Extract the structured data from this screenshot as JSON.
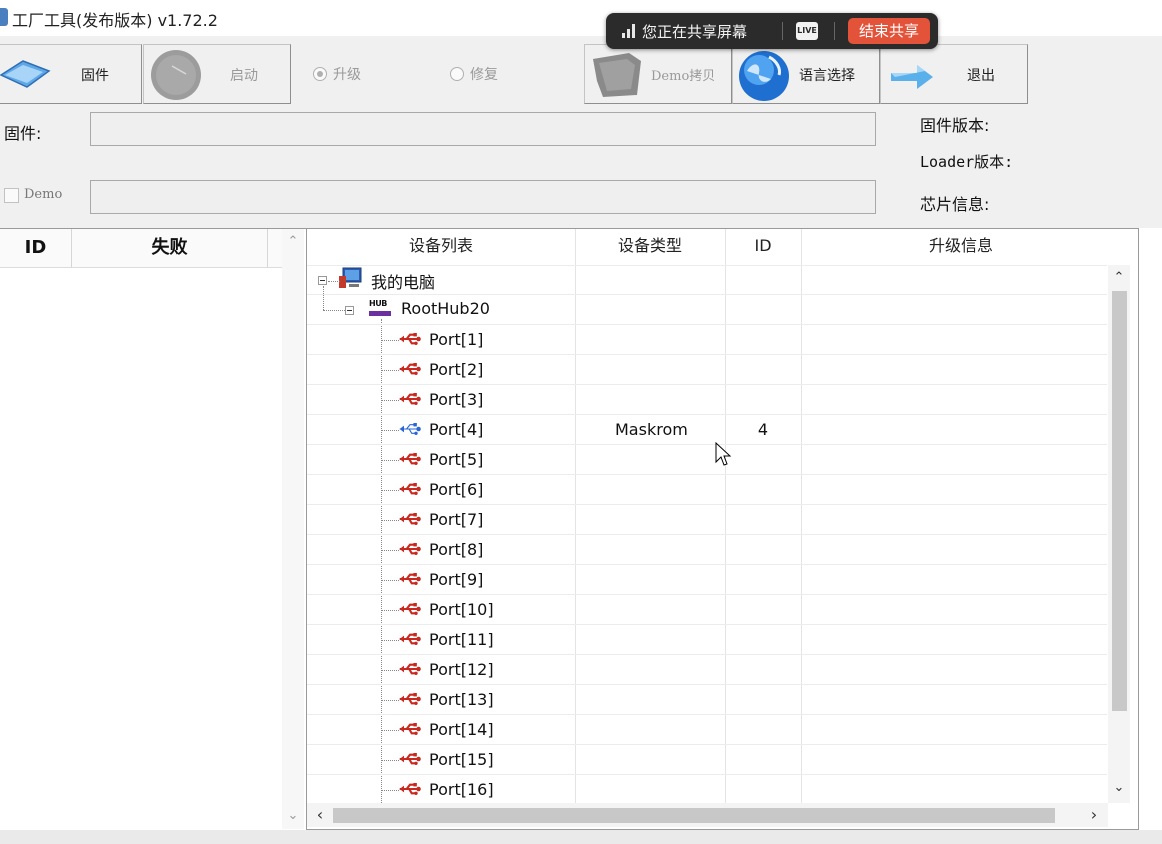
{
  "window": {
    "title": "工厂工具(发布版本) v1.72.2"
  },
  "share_bar": {
    "status": "您正在共享屏幕",
    "stop_label": "结束共享",
    "live_icon_text": "LIVE"
  },
  "toolbar": {
    "firmware_button": "固件",
    "start_button": "启动",
    "upgrade_radio": "升级",
    "repair_radio": "修复",
    "demo_copy_button": "Demo拷贝",
    "language_button": "语言选择",
    "exit_button": "退出"
  },
  "info": {
    "firmware_label": "固件:",
    "firmware_path": "",
    "demo_label": "Demo",
    "demo_path": "",
    "firmware_version_label": "固件版本:",
    "loader_version_label": "Loader版本:",
    "chip_info_label": "芯片信息:"
  },
  "left_table": {
    "columns": [
      "ID",
      "失败"
    ]
  },
  "device_table": {
    "columns": [
      "设备列表",
      "设备类型",
      "ID",
      "升级信息"
    ],
    "root": "我的电脑",
    "hub": "RootHub20",
    "hub_icon_text": "HUB",
    "ports": [
      {
        "name": "Port[1]",
        "type": "",
        "id": "",
        "info": "",
        "active": false
      },
      {
        "name": "Port[2]",
        "type": "",
        "id": "",
        "info": "",
        "active": false
      },
      {
        "name": "Port[3]",
        "type": "",
        "id": "",
        "info": "",
        "active": false
      },
      {
        "name": "Port[4]",
        "type": "Maskrom",
        "id": "4",
        "info": "",
        "active": true
      },
      {
        "name": "Port[5]",
        "type": "",
        "id": "",
        "info": "",
        "active": false
      },
      {
        "name": "Port[6]",
        "type": "",
        "id": "",
        "info": "",
        "active": false
      },
      {
        "name": "Port[7]",
        "type": "",
        "id": "",
        "info": "",
        "active": false
      },
      {
        "name": "Port[8]",
        "type": "",
        "id": "",
        "info": "",
        "active": false
      },
      {
        "name": "Port[9]",
        "type": "",
        "id": "",
        "info": "",
        "active": false
      },
      {
        "name": "Port[10]",
        "type": "",
        "id": "",
        "info": "",
        "active": false
      },
      {
        "name": "Port[11]",
        "type": "",
        "id": "",
        "info": "",
        "active": false
      },
      {
        "name": "Port[12]",
        "type": "",
        "id": "",
        "info": "",
        "active": false
      },
      {
        "name": "Port[13]",
        "type": "",
        "id": "",
        "info": "",
        "active": false
      },
      {
        "name": "Port[14]",
        "type": "",
        "id": "",
        "info": "",
        "active": false
      },
      {
        "name": "Port[15]",
        "type": "",
        "id": "",
        "info": "",
        "active": false
      },
      {
        "name": "Port[16]",
        "type": "",
        "id": "",
        "info": "",
        "active": false
      }
    ]
  },
  "colors": {
    "usb_inactive": "#c8281e",
    "usb_active": "#2a66d8",
    "stop_share": "#e2533a"
  }
}
